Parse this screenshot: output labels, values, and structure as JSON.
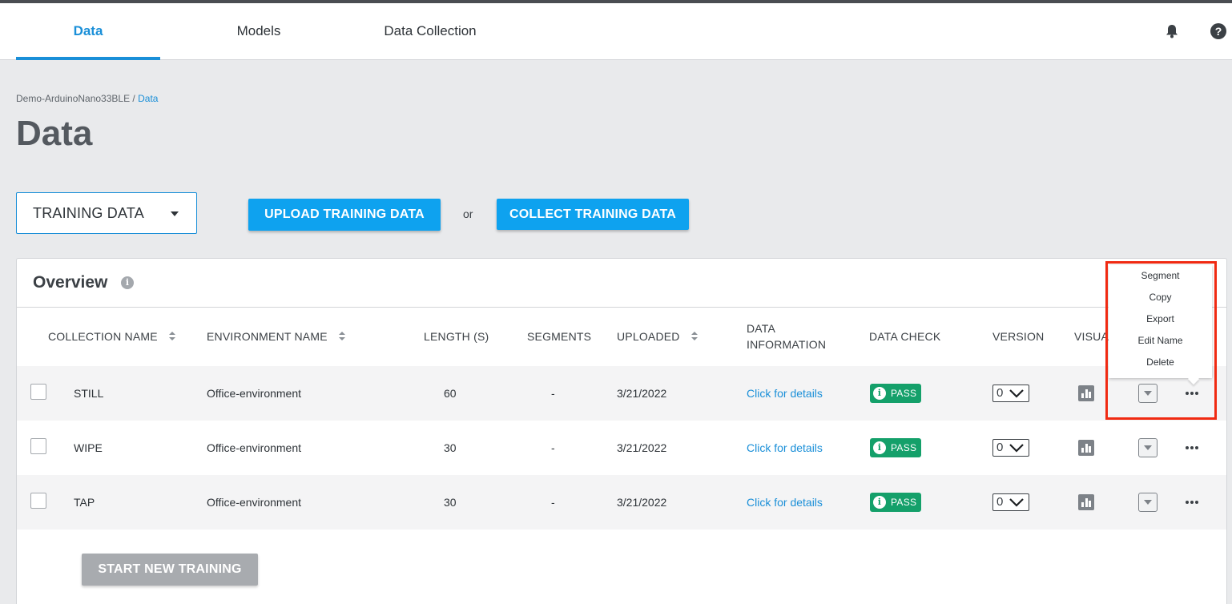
{
  "nav": {
    "tabs": [
      {
        "label": "Data",
        "active": true
      },
      {
        "label": "Models",
        "active": false
      },
      {
        "label": "Data Collection",
        "active": false
      }
    ],
    "icons": [
      "bell-icon",
      "help-icon"
    ],
    "accent_color": "#1a8fd8"
  },
  "breadcrumb": {
    "project": "Demo-ArduinoNano33BLE",
    "separator": " / ",
    "current": "Data"
  },
  "page": {
    "title": "Data"
  },
  "data_type_select": {
    "value": "TRAINING DATA"
  },
  "actions": {
    "upload_label": "UPLOAD TRAINING DATA",
    "or_label": "or",
    "collect_label": "COLLECT TRAINING DATA",
    "start_training_label": "START NEW TRAINING",
    "primary_color": "#0ea2ef"
  },
  "overview": {
    "title": "Overview",
    "info_glyph": "i",
    "columns": [
      "COLLECTION NAME",
      "ENVIRONMENT NAME",
      "LENGTH (S)",
      "SEGMENTS",
      "UPLOADED",
      "DATA INFORMATION",
      "DATA CHECK",
      "VERSION",
      "VISUA"
    ],
    "rows": [
      {
        "name": "STILL",
        "environment": "Office-environment",
        "length": "60",
        "segments": "-",
        "uploaded": "3/21/2022",
        "info": "Click for details",
        "check": "PASS",
        "version": "0"
      },
      {
        "name": "WIPE",
        "environment": "Office-environment",
        "length": "30",
        "segments": "-",
        "uploaded": "3/21/2022",
        "info": "Click for details",
        "check": "PASS",
        "version": "0"
      },
      {
        "name": "TAP",
        "environment": "Office-environment",
        "length": "30",
        "segments": "-",
        "uploaded": "3/21/2022",
        "info": "Click for details",
        "check": "PASS",
        "version": "0"
      }
    ],
    "pass_color": "#14a06a"
  },
  "context_menu": {
    "items": [
      "Segment",
      "Copy",
      "Export",
      "Edit Name",
      "Delete"
    ],
    "highlight_color": "#f02a12"
  }
}
